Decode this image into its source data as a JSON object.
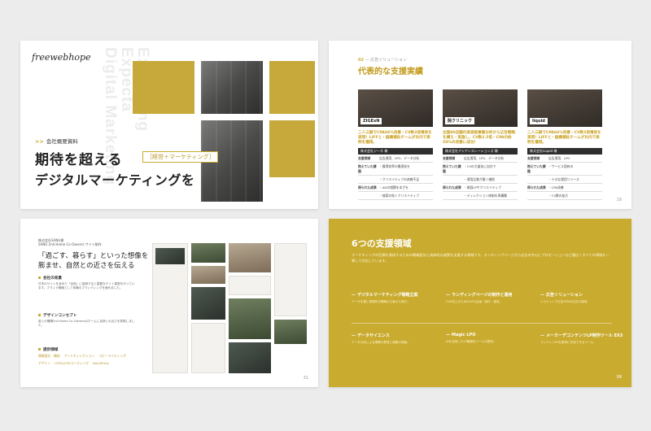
{
  "slide1": {
    "logo_text": "freewebhope",
    "vertical_text": [
      "Exceeding",
      "Expecta",
      "Digital Marketing"
    ],
    "label": "会社概要資料",
    "headline1": "期待を超える",
    "tag": "［経営＋マーケティング］",
    "headline2": "デジタルマーケティングを"
  },
  "slide2": {
    "section_label_num": "02",
    "section_label": "広告ソリューション",
    "title": "代表的な支援実績",
    "page": "19",
    "cases": [
      {
        "logo": "ZIGExN",
        "desc": "二人三脚でCPA66%改善・CV数3倍増長を実現！LIFFと・組織補佐チームが比内で表明を獲得。",
        "bar": "株式会社ジーネ 様",
        "rows": [
          {
            "k": "支援領域",
            "v": "広告運用、LPO、データ分析"
          },
          {
            "k": "抱えていた課題",
            "v": "・獲得効率の最適化を"
          },
          {
            "k": "",
            "v": "・クリエイティブの改善不足"
          },
          {
            "k": "得られた成果",
            "v": "・ADの相関を本ざを"
          },
          {
            "k": "",
            "v": "・検索の効くクリエイティブ"
          }
        ]
      },
      {
        "logo": "院クリニック",
        "desc": "全国80店舗の美容医療業分析から広告戦略を構え・実施し、CV数2.5倍・CPAの約50%の改善に成功！",
        "bar": "株式会社アジアンスレーションズ 様",
        "rows": [
          {
            "k": "支援領域",
            "v": "広告運用、LPO、データ分析"
          },
          {
            "k": "抱えていた課題",
            "v": "・CVの大量化に自社で"
          },
          {
            "k": "",
            "v": "・運用品質が悪く継続"
          },
          {
            "k": "得られた成果",
            "v": "・美容LPやクリエイティブ"
          },
          {
            "k": "",
            "v": "・ディレクション体制を再構築"
          }
        ]
      },
      {
        "logo": "liquid",
        "desc": "二人三脚でCPA66%改善・CV数3倍増長を実現！LIFFと・組織補佐チームが比内で表明を獲得。",
        "bar": "株式会社Liquid 様",
        "rows": [
          {
            "k": "支援領域",
            "v": "広告運用、LPO"
          },
          {
            "k": "抱えていた課題",
            "v": "・サービス固有の"
          },
          {
            "k": "",
            "v": "・十分な運用リソース"
          },
          {
            "k": "得られた成果",
            "v": "・CPA改善"
          },
          {
            "k": "",
            "v": "・CV数の拡大"
          }
        ]
      }
    ]
  },
  "slide3": {
    "client": "株式会社SANU様",
    "client_sub": "SANU 2nd Home Co-Owners サイト制作",
    "title": [
      "「過ごす、暮らす」といった想像を",
      "膨ませ、自然との近さを伝える"
    ],
    "sections": [
      {
        "title": "会社の背景",
        "body": "日本のサイトを含めた「自然」に接続すると重要なサイト運営を行っています。ブランド戦略として体験のブランディングを進めました。"
      },
      {
        "title": "デザインコンセプト",
        "body": "各との間隔2nd Home Co-Ownersのホームに自然との近さを表現しました。"
      },
      {
        "title": "提供領域",
        "body": ""
      }
    ],
    "tags": [
      "情報設計・構成",
      "アートディレクション",
      "コピーライティング",
      "デザイン",
      "HTML/CSSコーディング",
      "WordPress"
    ],
    "page": "31"
  },
  "slide4": {
    "title": "6つの支援領域",
    "desc": "マーケティングの目標を達成するための戦略設計と具体的な施策を支援する領域です。ランディングページから広告を中心にプロモーションなど幅広くすべての領域を一貫して対応しています。",
    "page": "09",
    "services": [
      {
        "title": "デジタルマーケティング戦略立案",
        "desc": "データを基に長期的な戦略の立案から実行。"
      },
      {
        "title": "ランディングページの制作と運用",
        "desc": "CVR向上のためのLPの企画・制作・運用。"
      },
      {
        "title": "広告ソリューション",
        "desc": "リスティング広告やSNS広告の運用。"
      },
      {
        "title": "データサイエンス",
        "desc": "データ分析による課題の発見と施策の提案。"
      },
      {
        "title": "Magic LPO",
        "desc": "AIを活用したLP最適化ツールの提供。"
      },
      {
        "title": "メーカーデコンテンツLP制作ツール EX3",
        "desc": "コンテンツLPを簡単に作成できるツール。"
      }
    ]
  }
}
